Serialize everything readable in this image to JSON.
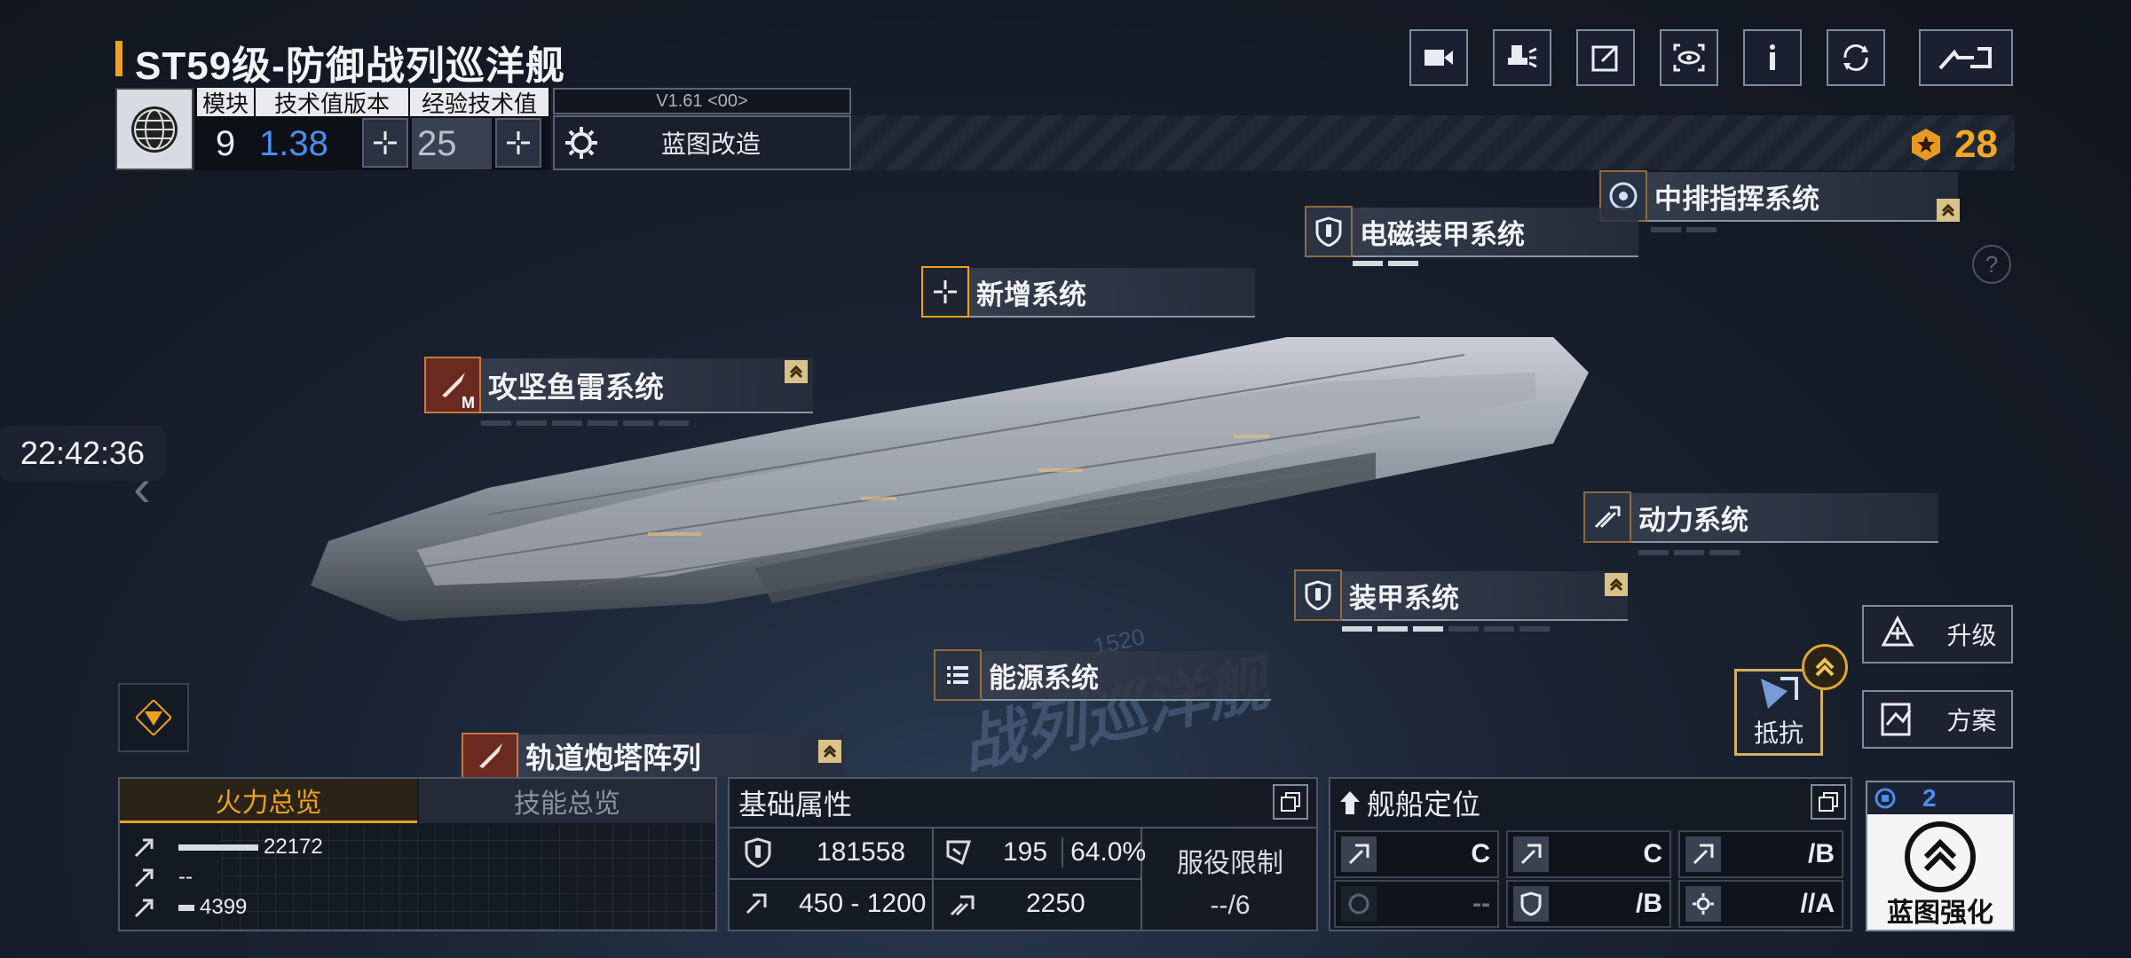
{
  "header": {
    "title": "ST59级-防御战列巡洋舰",
    "toolbar_icons": [
      "video-camera-icon",
      "blueprint-view-icon",
      "share-icon",
      "eye-scan-icon",
      "info-icon",
      "refresh-icon",
      "back-icon"
    ]
  },
  "info": {
    "module_label": "模块",
    "module_value": "9",
    "tech_version_label": "技术值版本",
    "tech_version_value": "1.38",
    "exp_tech_label": "经验技术值",
    "exp_tech_value": "25",
    "version": "V1.61 <00>",
    "blueprint_mod_label": "蓝图改造",
    "currency_value": "28"
  },
  "systems": {
    "command": "中排指挥系统",
    "em_armor": "电磁装甲系统",
    "add": "新增系统",
    "torpedo": "攻坚鱼雷系统",
    "torpedo_badge": "M",
    "power": "动力系统",
    "armor": "装甲系统",
    "energy": "能源系统",
    "rail_turret": "轨道炮塔阵列"
  },
  "watermark": {
    "text": "战列巡洋舰",
    "number": "1520"
  },
  "side": {
    "clock": "22:42:36",
    "upgrade": "升级",
    "plan": "方案",
    "resist": "抵抗",
    "help": "?"
  },
  "fire_panel": {
    "tab_fire": "火力总览",
    "tab_skill": "技能总览",
    "rows": [
      {
        "value": "22172",
        "fill": 1.0
      },
      {
        "value": "--",
        "fill": 0
      },
      {
        "value": "4399",
        "fill": 0.2
      }
    ]
  },
  "stat_panel": {
    "title": "基础属性",
    "hp": "181558",
    "armor": "195",
    "armor_pct": "64.0%",
    "speed_range": "450 - 1200",
    "warp": "2250",
    "service_label": "服役限制",
    "service_value": "--/6"
  },
  "role_panel": {
    "title": "舰船定位",
    "cells": [
      {
        "grade": "C",
        "icon": "attack-icon"
      },
      {
        "grade": "C",
        "icon": "attack-icon"
      },
      {
        "grade": "/B",
        "icon": "attack-icon"
      },
      {
        "grade": "--",
        "icon": "disabled-icon"
      },
      {
        "grade": "/B",
        "icon": "shield-icon"
      },
      {
        "grade": "//A",
        "icon": "gear-icon"
      }
    ]
  },
  "enhance": {
    "level": "2",
    "label": "蓝图强化"
  },
  "colors": {
    "accent": "#f0a020",
    "tech_blue": "#4a8ef0"
  }
}
